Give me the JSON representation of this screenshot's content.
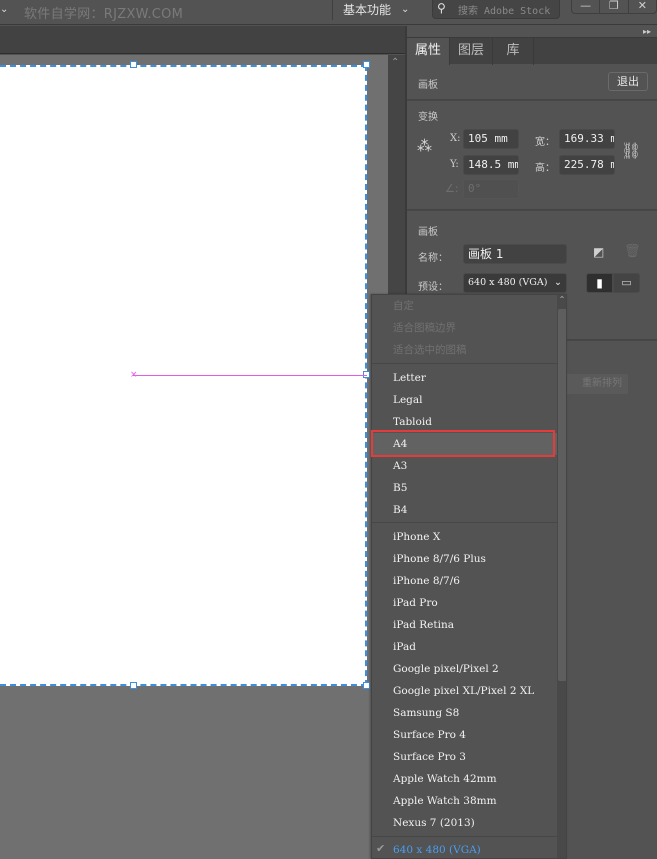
{
  "topbar": {
    "watermark": "软件自学网：RJZXW.COM",
    "workspace": "基本功能",
    "search_placeholder": "搜索 Adobe Stock",
    "window_buttons": [
      "minimize",
      "restore",
      "close"
    ]
  },
  "panel": {
    "tabs": [
      {
        "label": "属性",
        "active": true
      },
      {
        "label": "图层",
        "active": false
      },
      {
        "label": "库",
        "active": false
      }
    ],
    "artboard_header": {
      "title": "画板",
      "exit_label": "退出"
    },
    "transform": {
      "title": "变换",
      "x_label": "X:",
      "x_value": "105 mm",
      "y_label": "Y:",
      "y_value": "148.5 mm",
      "w_label": "宽：",
      "w_value": "169.33 m",
      "h_label": "高：",
      "h_value": "225.78 m",
      "angle_value": "0°"
    },
    "artboard": {
      "title": "画板",
      "name_label": "名称：",
      "name_value": "画板 1",
      "preset_label": "预设：",
      "preset_value": "640 x 480 (VGA)",
      "rearrange_label": "重新排列"
    }
  },
  "dropdown": {
    "groups": [
      [
        {
          "label": "自定",
          "disabled": true
        },
        {
          "label": "适合图稿边界",
          "disabled": true
        },
        {
          "label": "适合选中的图稿",
          "disabled": true
        }
      ],
      [
        {
          "label": "Letter"
        },
        {
          "label": "Legal"
        },
        {
          "label": "Tabloid"
        },
        {
          "label": "A4",
          "highlighted": true
        },
        {
          "label": "A3"
        },
        {
          "label": "B5"
        },
        {
          "label": "B4"
        }
      ],
      [
        {
          "label": "iPhone X"
        },
        {
          "label": "iPhone 8/7/6 Plus"
        },
        {
          "label": "iPhone 8/7/6"
        },
        {
          "label": "iPad Pro"
        },
        {
          "label": "iPad Retina"
        },
        {
          "label": "iPad"
        },
        {
          "label": "Google pixel/Pixel 2"
        },
        {
          "label": "Google pixel XL/Pixel 2 XL"
        },
        {
          "label": "Samsung S8"
        },
        {
          "label": "Surface Pro 4"
        },
        {
          "label": "Surface Pro 3"
        },
        {
          "label": "Apple Watch 42mm"
        },
        {
          "label": "Apple Watch 38mm"
        },
        {
          "label": "Nexus 7 (2013)"
        }
      ],
      [
        {
          "label": "640 x 480 (VGA)",
          "selected": true
        }
      ]
    ]
  },
  "colors": {
    "selection_blue": "#3d8fe0",
    "guide_magenta": "#e25ce8",
    "highlight_red": "#e63b3b",
    "selected_text": "#4a9ef0"
  }
}
